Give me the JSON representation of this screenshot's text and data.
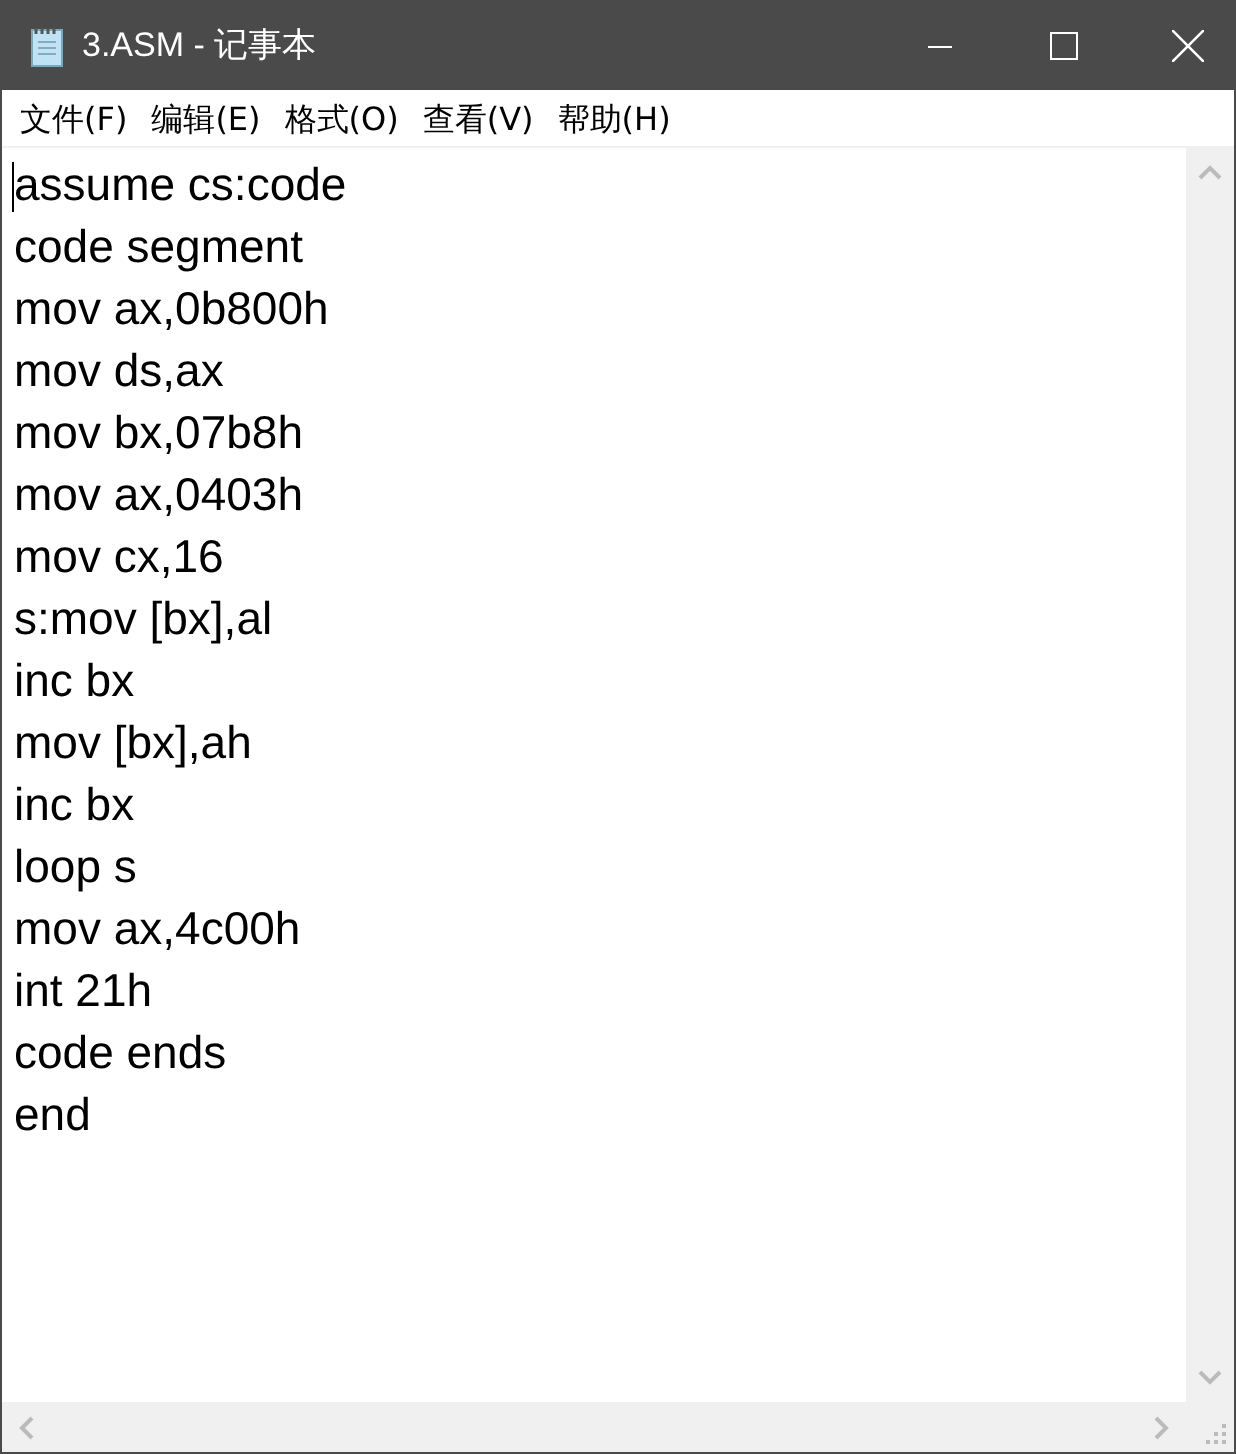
{
  "window": {
    "title": "3.ASM - 记事本"
  },
  "menu": [
    "文件(F)",
    "编辑(E)",
    "格式(O)",
    "查看(V)",
    "帮助(H)"
  ],
  "editor": {
    "lines": [
      "assume cs:code",
      "code segment",
      "mov ax,0b800h",
      "mov ds,ax",
      "mov bx,07b8h",
      "mov ax,0403h",
      "mov cx,16",
      "s:mov [bx],al",
      "inc bx",
      "mov [bx],ah",
      "inc bx",
      "loop s",
      "mov ax,4c00h",
      "int 21h",
      "code ends",
      "end"
    ]
  }
}
